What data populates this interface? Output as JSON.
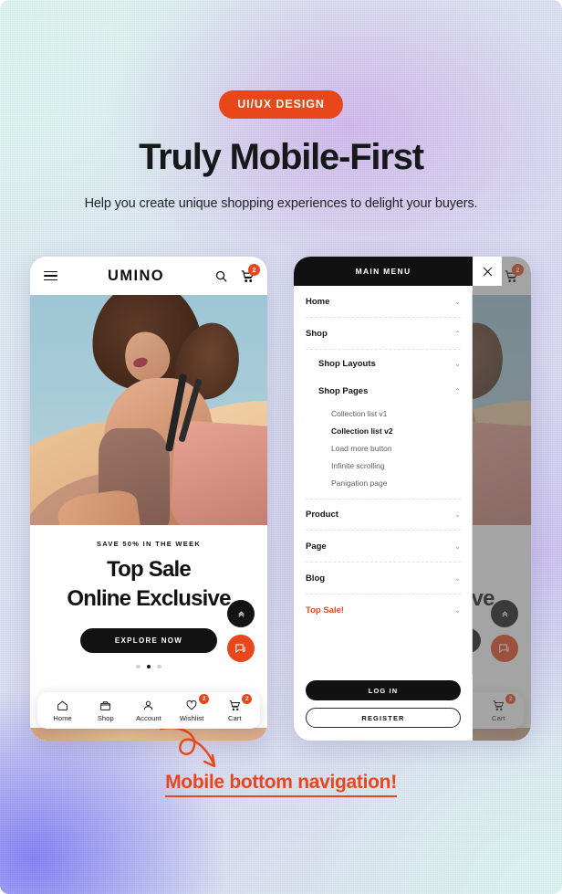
{
  "header": {
    "pill": "UI/UX DESIGN",
    "title": "Truly Mobile-First",
    "subtitle": "Help you create unique shopping experiences to delight your buyers."
  },
  "store": {
    "logo": "UMINO",
    "menu_icon": "hamburger-icon",
    "search_icon": "search-icon",
    "cart_icon": "cart-icon",
    "cart_badge": "2",
    "hero": {
      "kicker": "SAVE 50% IN THE WEEK",
      "headline_line1": "Top Sale",
      "headline_line2": "Online Exclusive",
      "cta": "EXPLORE NOW",
      "slides": 3,
      "active_slide": 2
    },
    "fabs": [
      {
        "name": "scroll-to-top-button",
        "glyph": "»",
        "color": "#141414"
      },
      {
        "name": "chat-button",
        "glyph": "□",
        "color": "#E8471C"
      }
    ],
    "bottom_nav": [
      {
        "label": "Home",
        "icon": "home-icon",
        "badge": ""
      },
      {
        "label": "Shop",
        "icon": "shop-icon",
        "badge": ""
      },
      {
        "label": "Account",
        "icon": "account-icon",
        "badge": ""
      },
      {
        "label": "Wishlist",
        "icon": "heart-icon",
        "badge": "2"
      },
      {
        "label": "Cart",
        "icon": "cart-icon",
        "badge": "2"
      }
    ]
  },
  "drawer": {
    "title": "MAIN MENU",
    "close_icon": "close-icon",
    "items": [
      {
        "label": "Home",
        "chev": "⌄",
        "level": 0,
        "state": "collapsed"
      },
      {
        "label": "Shop",
        "chev": "⌃",
        "level": 0,
        "state": "expanded"
      }
    ],
    "shop_children": [
      {
        "label": "Shop Layouts",
        "chev": "⌄",
        "state": "collapsed"
      },
      {
        "label": "Shop Pages",
        "chev": "⌃",
        "state": "expanded"
      }
    ],
    "shop_pages": [
      {
        "label": "Collection list v1",
        "active": false
      },
      {
        "label": "Collection list v2",
        "active": true
      },
      {
        "label": "Load more button",
        "active": false
      },
      {
        "label": "Infinite scrolling",
        "active": false
      },
      {
        "label": "Panigation page",
        "active": false
      }
    ],
    "tail_items": [
      {
        "label": "Product",
        "chev": "⌄",
        "hot": false
      },
      {
        "label": "Page",
        "chev": "⌄",
        "hot": false
      },
      {
        "label": "Blog",
        "chev": "⌄",
        "hot": false
      },
      {
        "label": "Top Sale!",
        "chev": "⌄",
        "hot": true
      }
    ],
    "login_label": "LOG IN",
    "register_label": "REGISTER"
  },
  "callout": {
    "text": "Mobile bottom navigation!"
  },
  "colors": {
    "accent": "#E8471C",
    "dark": "#121212",
    "bg_mint": "#dff3ef",
    "bg_lavender": "#d9d8f3",
    "bg_blue": "#7e7cf6"
  }
}
